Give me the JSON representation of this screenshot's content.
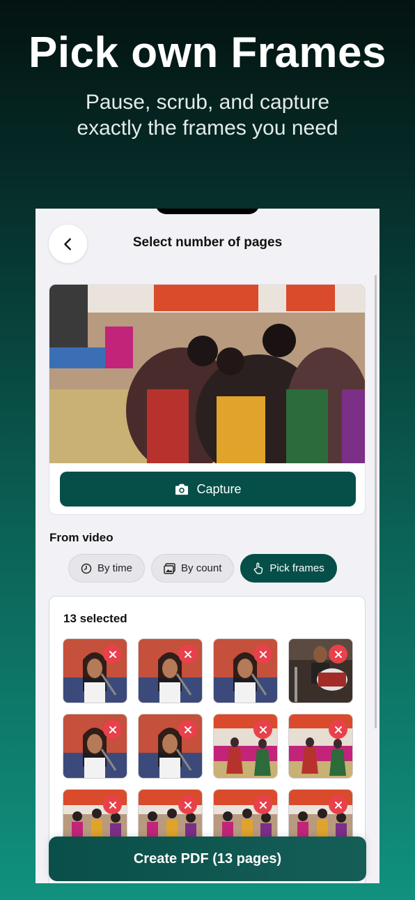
{
  "promo": {
    "headline": "Pick own Frames",
    "subline": "Pause, scrub, and capture\nexactly the frames you need"
  },
  "nav": {
    "back_icon": "chevron-left-icon",
    "title": "Select number of pages"
  },
  "capture": {
    "label": "Capture",
    "icon": "camera-icon"
  },
  "mode": {
    "section_label": "From video",
    "options": [
      {
        "label": "By time",
        "icon": "clock-icon",
        "active": false
      },
      {
        "label": "By count",
        "icon": "images-icon",
        "active": false
      },
      {
        "label": "Pick frames",
        "icon": "hand-pointer-icon",
        "active": true
      }
    ]
  },
  "selection": {
    "count_label": "13 selected",
    "thumbnails": [
      {
        "scene": "singer"
      },
      {
        "scene": "singer"
      },
      {
        "scene": "singer"
      },
      {
        "scene": "drummer"
      },
      {
        "scene": "singer"
      },
      {
        "scene": "singer"
      },
      {
        "scene": "dance"
      },
      {
        "scene": "dance"
      },
      {
        "scene": "crowd"
      },
      {
        "scene": "crowd"
      },
      {
        "scene": "crowd"
      },
      {
        "scene": "crowd"
      }
    ]
  },
  "create": {
    "label": "Create PDF (13 pages)"
  },
  "colors": {
    "accent": "#064f48",
    "remove_badge": "#e8414b"
  }
}
